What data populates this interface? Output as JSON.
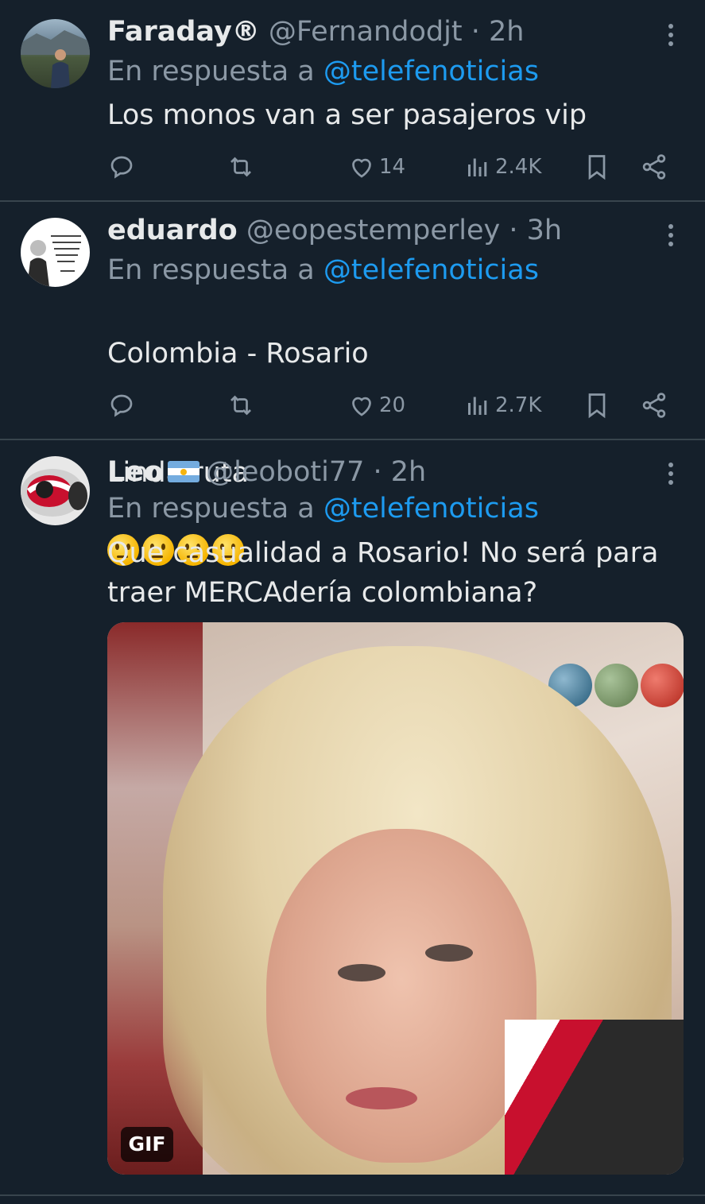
{
  "reply_prefix": "En respuesta a",
  "tweets": [
    {
      "name": "Faraday®",
      "handle": "@Fernandodjt",
      "time": "· 2h",
      "reply_to": "@telefenoticias",
      "text": "Los monos van a ser pasajeros vip",
      "likes": "14",
      "views": "2.4K"
    },
    {
      "name": "eduardo",
      "handle": "@eopestemperley",
      "time": "· 3h",
      "reply_to": "@telefenoticias",
      "text_line1": "Colombia - Rosario",
      "text_line2": "Linda ruta",
      "text_emojis": "🤔🤔🤔🤔",
      "avatar_quote": "\"Si no luchas, al menos ten la decencia de respetar a quienes sí lo hacen\". José Martí",
      "likes": "20",
      "views": "2.7K"
    },
    {
      "name": "Leo",
      "flag": "🇦🇷",
      "handle": "@leoboti77",
      "time": "· 2h",
      "reply_to": "@telefenoticias",
      "text": "Que casualidad a Rosario! No será para traer MERCAdería colombiana?",
      "media_badge": "GIF"
    }
  ],
  "icons": [
    "more-icon",
    "reply-icon",
    "retweet-icon",
    "like-icon",
    "views-icon",
    "bookmark-icon",
    "share-icon"
  ],
  "colors": {
    "background": "#15202b",
    "divider": "#38444d",
    "mention": "#1d9bf0",
    "muted": "#8b98a5",
    "text": "#e7e9ea"
  }
}
